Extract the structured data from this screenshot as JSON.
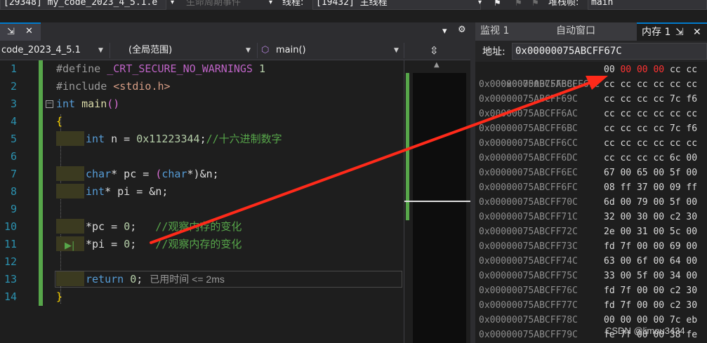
{
  "toolbar": {
    "process": "[29348] my_code_2023_4_5.1.e",
    "lifecycle_events": "生命周期事件",
    "thread_label": "线程:",
    "thread": "[19432] 主线程",
    "stackframe_label": "堆栈帧:",
    "stackframe": "main"
  },
  "editor_tab": {
    "pin": "⇲",
    "close": "✕",
    "dropdown": "▾",
    "settings": "⚙"
  },
  "navbar": {
    "project": "code_2023_4_5.1",
    "scope": "(全局范围)",
    "function": "main()"
  },
  "code": {
    "lines": [
      {
        "n": "1"
      },
      {
        "n": "2"
      },
      {
        "n": "3"
      },
      {
        "n": "4"
      },
      {
        "n": "5"
      },
      {
        "n": "6"
      },
      {
        "n": "7"
      },
      {
        "n": "8"
      },
      {
        "n": "9"
      },
      {
        "n": "10"
      },
      {
        "n": "11"
      },
      {
        "n": "12"
      },
      {
        "n": "13"
      },
      {
        "n": "14"
      }
    ],
    "l1_dir": "#define",
    "l1_macro": "_CRT_SECURE_NO_WARNINGS",
    "l1_val": "1",
    "l2_dir": "#include",
    "l2_hdr": "<stdio.h>",
    "l3_kw": "int",
    "l3_fn": "main",
    "l3_parens": "()",
    "l4": "{",
    "l5_kw": "int",
    "l5_rest": "n = ",
    "l5_num": "0x11223344",
    "l5_semi": ";",
    "l5_cm": "//十六进制数字",
    "l7_kw": "char",
    "l7_rest": "* pc = ",
    "l7_cast_open": "(",
    "l7_cast_kw": "char",
    "l7_cast_close": "*)",
    "l7_end": "&n;",
    "l8_kw": "int",
    "l8_rest": "* pi = &n;",
    "l10_code": "*pc = ",
    "l10_num": "0",
    "l10_semi": ";",
    "l10_cm": "//观察内存的变化",
    "l11_code": "*pi = ",
    "l11_num": "0",
    "l11_semi": ";",
    "l11_cm": "//观察内存的变化",
    "l13_kw": "return",
    "l13_num": "0",
    "l13_semi": ";",
    "l13_elapsed": "已用时间 <= 2ms",
    "l14": "}"
  },
  "memory_window": {
    "tabs": [
      "监视 1",
      "自动窗口",
      "内存 1"
    ],
    "address_label": "地址:",
    "address_value": "0x00000075ABCFF67C",
    "rows": [
      {
        "addr": "0x00000075ABCFF67C",
        "b0": "00",
        "b1": "00 00 00",
        "rest": "cc cc"
      },
      {
        "addr": "0x00000075ABCFF68C",
        "b0": "cc",
        "b1": "",
        "rest": "cc cc cc cc cc"
      },
      {
        "addr": "0x00000075ABCFF69C",
        "b0": "cc",
        "b1": "",
        "rest": "cc cc cc 7c f6"
      },
      {
        "addr": "0x00000075ABCFF6AC",
        "b0": "cc",
        "b1": "",
        "rest": "cc cc cc cc cc"
      },
      {
        "addr": "0x00000075ABCFF6BC",
        "b0": "cc",
        "b1": "",
        "rest": "cc cc cc 7c f6"
      },
      {
        "addr": "0x00000075ABCFF6CC",
        "b0": "cc",
        "b1": "",
        "rest": "cc cc cc cc cc"
      },
      {
        "addr": "0x00000075ABCFF6DC",
        "b0": "cc",
        "b1": "",
        "rest": "cc cc cc 6c 00"
      },
      {
        "addr": "0x00000075ABCFF6EC",
        "b0": "67",
        "b1": "",
        "rest": "00 65 00 5f 00"
      },
      {
        "addr": "0x00000075ABCFF6FC",
        "b0": "08",
        "b1": "",
        "rest": "ff 37 00 09 ff"
      },
      {
        "addr": "0x00000075ABCFF70C",
        "b0": "6d",
        "b1": "",
        "rest": "00 79 00 5f 00"
      },
      {
        "addr": "0x00000075ABCFF71C",
        "b0": "32",
        "b1": "",
        "rest": "00 30 00 c2 30"
      },
      {
        "addr": "0x00000075ABCFF72C",
        "b0": "2e",
        "b1": "",
        "rest": "00 31 00 5c 00"
      },
      {
        "addr": "0x00000075ABCFF73C",
        "b0": "fd",
        "b1": "",
        "rest": "7f 00 00 69 00"
      },
      {
        "addr": "0x00000075ABCFF74C",
        "b0": "63",
        "b1": "",
        "rest": "00 6f 00 64 00"
      },
      {
        "addr": "0x00000075ABCFF75C",
        "b0": "33",
        "b1": "",
        "rest": "00 5f 00 34 00"
      },
      {
        "addr": "0x00000075ABCFF76C",
        "b0": "fd",
        "b1": "",
        "rest": "7f 00 00 c2 30"
      },
      {
        "addr": "0x00000075ABCFF77C",
        "b0": "fd",
        "b1": "",
        "rest": "7f 00 00 c2 30"
      },
      {
        "addr": "0x00000075ABCFF78C",
        "b0": "00",
        "b1": "",
        "rest": "00 00 00 7c eb"
      },
      {
        "addr": "0x00000075ABCFF79C",
        "b0": "fe",
        "b1": "",
        "rest": "7f 00 00 38 fe"
      }
    ]
  },
  "watermark": "CSDN @limou3434",
  "colors": {
    "annotation_arrow": "#ff2a1a",
    "changed_bytes": "#ff3333",
    "accent": "#007acc"
  }
}
